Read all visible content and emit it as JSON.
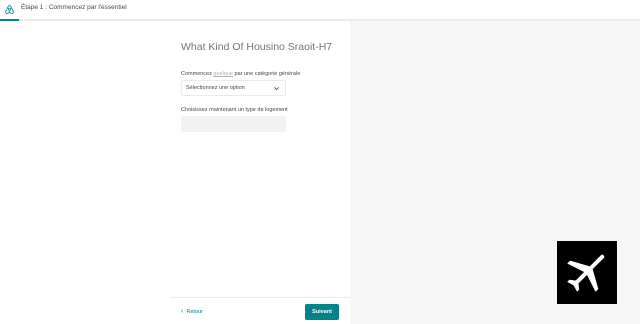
{
  "header": {
    "logo_icon": "airbnb-logo-icon",
    "step_title": "Étape 1 : Commencez par l'essentiel"
  },
  "progress": {
    "fraction": 0.03,
    "color": "#008489"
  },
  "form": {
    "heading": "What Kind Of Housino Sraoit-H7",
    "category_label_prefix": "Commencez ",
    "category_label_link": "quelque",
    "category_label_suffix": " par une catégorie générale",
    "category_select": {
      "value": "Sélectionnez une option",
      "icon": "chevron-down-icon"
    },
    "type_label": "Choisissez maintenant un type de logement"
  },
  "footer": {
    "back_label": "Retour",
    "back_icon": "chevron-left-icon",
    "next_label": "Suivant"
  },
  "overlay": {
    "icon": "airplane-icon"
  },
  "colors": {
    "accent": "#008489",
    "right_panel": "#f7f7f7"
  }
}
